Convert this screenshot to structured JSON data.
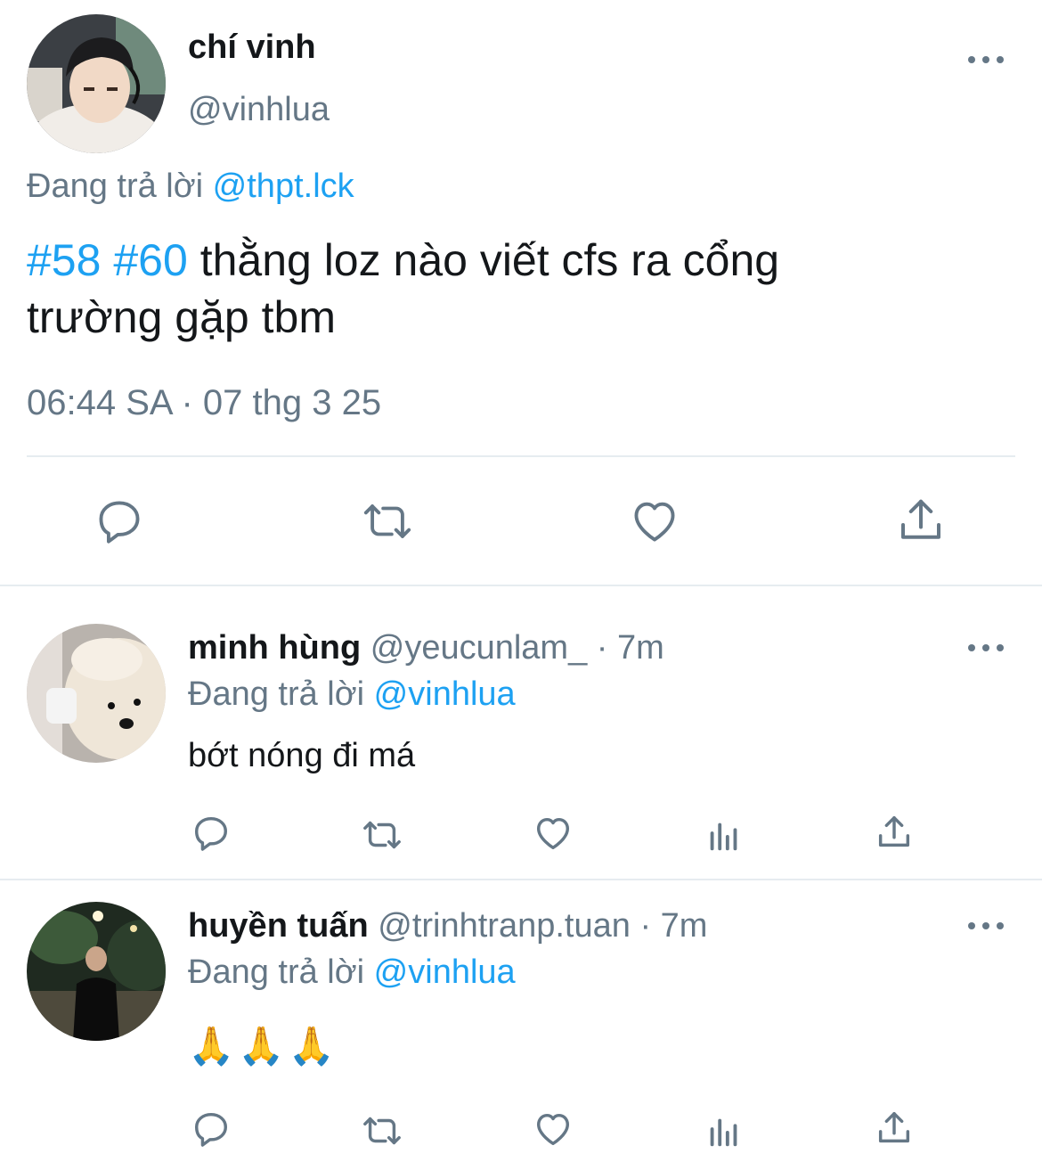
{
  "main_tweet": {
    "name": "chí vinh",
    "handle": "@vinhlua",
    "replying_label": "Đang trả lời",
    "replying_to": "@thpt.lck",
    "hashtags": [
      "#58",
      "#60"
    ],
    "text_line1": "thằng loz nào viết cfs ra cổng",
    "text_line2": "trường gặp tbm",
    "timestamp": "06:44 SA · 07 thg 3 25"
  },
  "replies": [
    {
      "name": "minh hùng",
      "handle": "@yeucunlam_",
      "time": " · 7m",
      "replying_label": "Đang trả lời",
      "replying_to": "@vinhlua",
      "text": "bớt nóng đi má"
    },
    {
      "name": "huyền tuấn",
      "handle": "@trinhtranp.tuan",
      "time": " · 7m",
      "replying_label": "Đang trả lời",
      "replying_to": "@vinhlua",
      "text": "🙏🙏🙏"
    }
  ],
  "icons": {
    "reply": "reply-icon",
    "retweet": "retweet-icon",
    "like": "like-icon",
    "views": "views-icon",
    "share": "share-icon",
    "more": "more-icon"
  },
  "colors": {
    "link": "#1da1f2",
    "muted": "#657786",
    "text": "#14171a",
    "divider": "#e6ecf0"
  }
}
